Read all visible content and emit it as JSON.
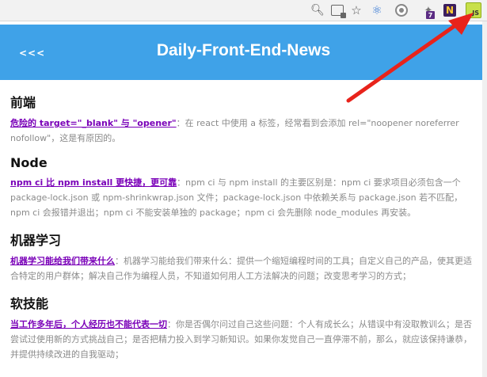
{
  "browser_toolbar": {
    "icons": [
      "zoom-icon",
      "translate-icon",
      "star-icon",
      "react-devtools-icon",
      "target-icon",
      "puzzle-extension-icon",
      "n-extension-icon",
      "js-extension-icon"
    ],
    "badge_count": "7",
    "n_label": "N",
    "js_label": "JS"
  },
  "header": {
    "back_label": "<<<",
    "title": "Daily-Front-End-News",
    "background_color": "#3fa2e8"
  },
  "sections": [
    {
      "title": "前端",
      "link": "危险的 target=\"_blank\" 与 \"opener\"",
      "separator": "：",
      "text": "在 react 中使用 a 标签，经常看到会添加 rel=\"noopener noreferrer nofollow\"，这是有原因的。"
    },
    {
      "title": "Node",
      "link": "npm ci 比 npm install 更快捷，更可靠",
      "separator": "：",
      "text": "npm ci 与 npm install 的主要区别是：npm ci 要求项目必须包含一个 package-lock.json 或 npm-shrinkwrap.json 文件；package-lock.json 中依赖关系与 package.json 若不匹配，npm ci 会报错并退出；npm ci 不能安装单独的 package；npm ci 会先删除 node_modules 再安装。"
    },
    {
      "title": "机器学习",
      "link": "机器学习能给我们带来什么",
      "separator": "：",
      "text": "机器学习能给我们带来什么：提供一个缩短编程时间的工具；自定义自己的产品，使其更适合特定的用户群体；解决自己作为编程人员，不知道如何用人工方法解决的问题；改变思考学习的方式；"
    },
    {
      "title": "软技能",
      "link": "当工作多年后，个人经历也不能代表一切",
      "separator": "：",
      "text": "你是否偶尔问过自己这些问题：个人有成长么；从错误中有没取教训么；是否尝试过使用新的方式挑战自己；是否把精力投入到学习新知识。如果你发觉自己一直停滞不前，那么，就应该保持谦恭，并提供持续改进的自我驱动；"
    }
  ],
  "annotation": {
    "arrow_color": "#e8231b"
  }
}
